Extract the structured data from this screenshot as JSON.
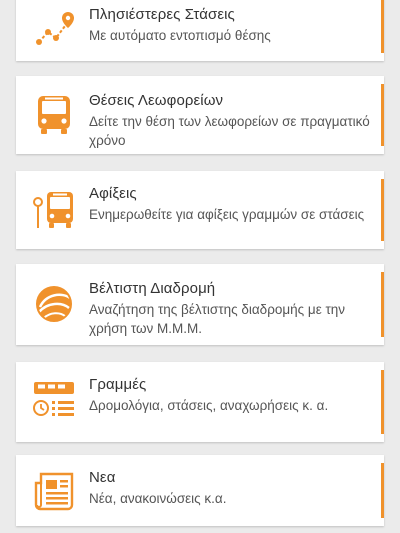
{
  "accent": "#f0922c",
  "menu": [
    {
      "icon": "route-pin-icon",
      "title": "Πλησιέστερες Στάσεις",
      "subtitle": "Με αυτόματο εντοπισμό θέσης"
    },
    {
      "icon": "bus-icon",
      "title": "Θέσεις Λεωφορείων",
      "subtitle": "Δείτε την θέση των λεωφορείων σε πραγματικό χρόνο"
    },
    {
      "icon": "bus-stop-icon",
      "title": "Αφίξεις",
      "subtitle": "Ενημερωθείτε για αφίξεις γραμμών σε στάσεις"
    },
    {
      "icon": "globe-route-icon",
      "title": "Βέλτιστη Διαδρομή",
      "subtitle": "Αναζήτηση της βέλτιστης διαδρομής με την χρήση των Μ.Μ.Μ."
    },
    {
      "icon": "timetable-icon",
      "title": "Γραμμές",
      "subtitle": "Δρομολόγια, στάσεις, αναχωρήσεις κ. α."
    },
    {
      "icon": "newspaper-icon",
      "title": "Νεα",
      "subtitle": "Νέα, ανακοινώσεις κ.α."
    }
  ]
}
